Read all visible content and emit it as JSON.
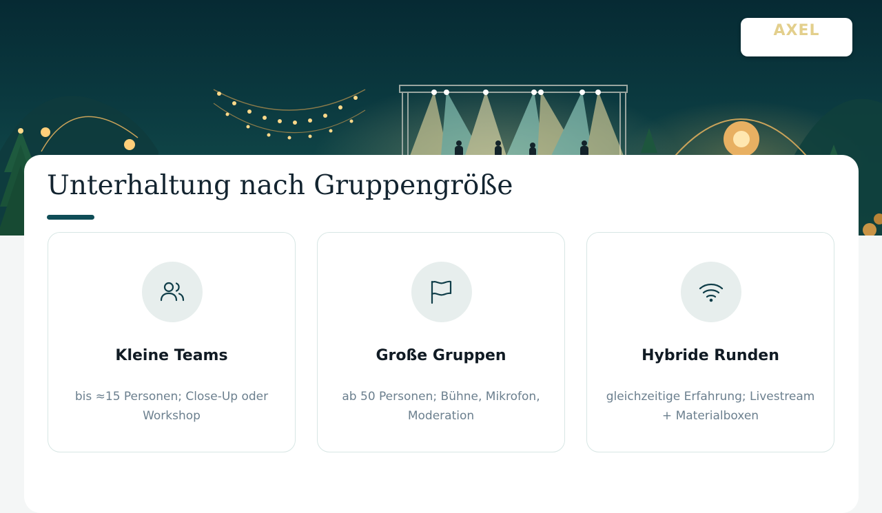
{
  "header": {
    "logo_text": "AXEL",
    "logo_color": "#e3cf8c"
  },
  "section": {
    "title": "Unterhaltung nach Gruppengröße",
    "accent_color": "#0f4d57"
  },
  "cards": [
    {
      "icon": "users-icon",
      "title": "Kleine Teams",
      "description": "bis ≈15 Personen; Close-Up oder Workshop"
    },
    {
      "icon": "flag-icon",
      "title": "Große Gruppen",
      "description": "ab 50 Personen; Bühne, Mikrofon, Moderation"
    },
    {
      "icon": "wifi-icon",
      "title": "Hybride Runden",
      "description": "gleichzeitige Erfahrung; Livestream + Materialboxen"
    }
  ]
}
